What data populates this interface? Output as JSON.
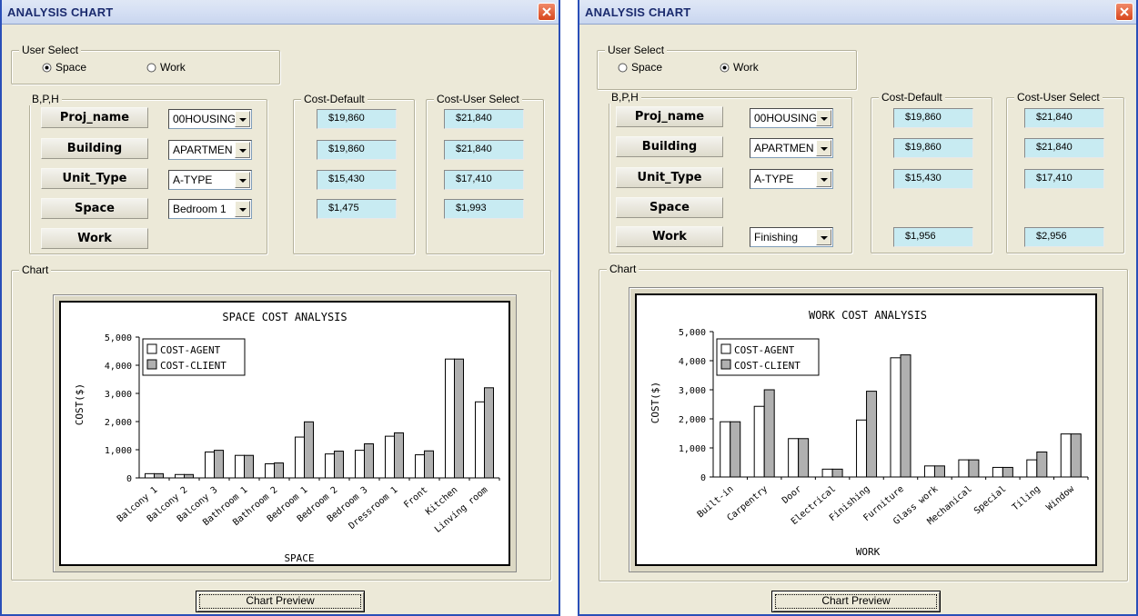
{
  "windows": [
    {
      "title": "ANALYSIS CHART",
      "user_select": {
        "legend": "User Select",
        "options": [
          "Space",
          "Work"
        ],
        "selected": "Space"
      },
      "bph": {
        "legend": "B,P,H",
        "rows": [
          {
            "label": "Proj_name",
            "combo": "00HOUSING",
            "default": "$19,860",
            "user": "$21,840"
          },
          {
            "label": "Building",
            "combo": "APARTMEN",
            "default": "$19,860",
            "user": "$21,840"
          },
          {
            "label": "Unit_Type",
            "combo": "A-TYPE",
            "default": "$15,430",
            "user": "$17,410"
          },
          {
            "label": "Space",
            "combo": "Bedroom 1",
            "default": "$1,475",
            "user": "$1,993"
          },
          {
            "label": "Work",
            "combo": "",
            "default": "",
            "user": ""
          }
        ]
      },
      "cost_default_legend": "Cost-Default",
      "cost_user_legend": "Cost-User Select",
      "chart_legend": "Chart",
      "preview_button": "Chart Preview"
    },
    {
      "title": "ANALYSIS CHART",
      "user_select": {
        "legend": "User Select",
        "options": [
          "Space",
          "Work"
        ],
        "selected": "Work"
      },
      "bph": {
        "legend": "B,P,H",
        "rows": [
          {
            "label": "Proj_name",
            "combo": "00HOUSING",
            "default": "$19,860",
            "user": "$21,840"
          },
          {
            "label": "Building",
            "combo": "APARTMEN",
            "default": "$19,860",
            "user": "$21,840"
          },
          {
            "label": "Unit_Type",
            "combo": "A-TYPE",
            "default": "$15,430",
            "user": "$17,410"
          },
          {
            "label": "Space",
            "combo": "",
            "default": "",
            "user": ""
          },
          {
            "label": "Work",
            "combo": "Finishing",
            "default": "$1,956",
            "user": "$2,956"
          }
        ]
      },
      "cost_default_legend": "Cost-Default",
      "cost_user_legend": "Cost-User Select",
      "chart_legend": "Chart",
      "preview_button": "Chart Preview"
    }
  ],
  "chart_data": [
    {
      "type": "bar",
      "title": "SPACE COST ANALYSIS",
      "xlabel": "SPACE",
      "ylabel": "COST($)",
      "ylim": [
        0,
        5000
      ],
      "yticks": [
        "0",
        "1,000",
        "2,000",
        "3,000",
        "4,000",
        "5,000"
      ],
      "legend_position": "top-left",
      "categories": [
        "Balcony 1",
        "Balcony 2",
        "Balcony 3",
        "Bathroom 1",
        "Bathroom 2",
        "Bedroom 1",
        "Bedroom 2",
        "Bedroom 3",
        "Dressroom 1",
        "Front",
        "Kitchen",
        "Linving room"
      ],
      "series": [
        {
          "name": "COST-AGENT",
          "color": "#ffffff",
          "values": [
            150,
            120,
            920,
            800,
            500,
            1450,
            850,
            980,
            1480,
            820,
            4220,
            2700
          ]
        },
        {
          "name": "COST-CLIENT",
          "color": "#b0b0b0",
          "values": [
            150,
            120,
            980,
            800,
            530,
            1990,
            950,
            1210,
            1600,
            960,
            4220,
            3200
          ]
        }
      ]
    },
    {
      "type": "bar",
      "title": "WORK COST ANALYSIS",
      "xlabel": "WORK",
      "ylabel": "COST($)",
      "ylim": [
        0,
        5000
      ],
      "yticks": [
        "0",
        "1,000",
        "2,000",
        "3,000",
        "4,000",
        "5,000"
      ],
      "legend_position": "top-left",
      "categories": [
        "Built-in",
        "Carpentry",
        "Door",
        "Electrical",
        "Finishing",
        "Furniture",
        "Glass work",
        "Mechanical",
        "Special",
        "Tiling",
        "Window"
      ],
      "series": [
        {
          "name": "COST-AGENT",
          "color": "#ffffff",
          "values": [
            1900,
            2430,
            1320,
            270,
            1960,
            4100,
            380,
            590,
            330,
            590,
            1480
          ]
        },
        {
          "name": "COST-CLIENT",
          "color": "#b0b0b0",
          "values": [
            1900,
            3000,
            1320,
            270,
            2950,
            4200,
            380,
            590,
            330,
            860,
            1480
          ]
        }
      ]
    }
  ]
}
